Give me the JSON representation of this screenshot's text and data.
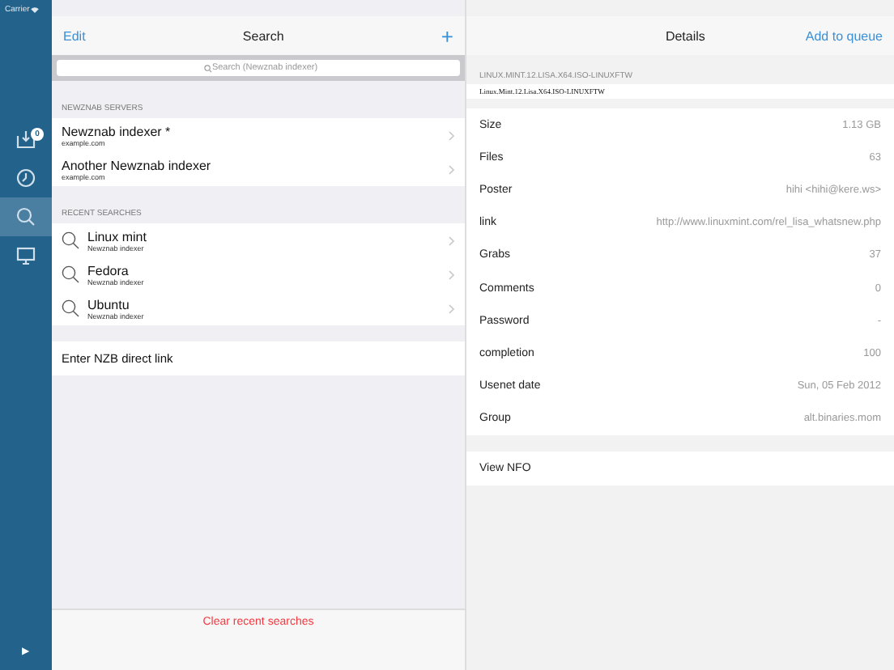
{
  "status_bar": {
    "carrier": "Carrier"
  },
  "sidebar": {
    "items": [
      {
        "kind": "downloads",
        "badge": "0",
        "selected": false
      },
      {
        "kind": "history",
        "selected": false
      },
      {
        "kind": "search",
        "selected": true
      },
      {
        "kind": "screen",
        "selected": false
      }
    ],
    "play": "▶"
  },
  "search_panel": {
    "edit": "Edit",
    "title": "Search",
    "add": "+",
    "search": {
      "placeholder": "Search (Newznab indexer)"
    },
    "sections": [
      {
        "header": "NEWZNAB SERVERS",
        "items": [
          {
            "kind": "server",
            "title": "Newznab indexer *",
            "subtitle": "example.com"
          },
          {
            "kind": "server",
            "title": "Another Newznab indexer",
            "subtitle": "example.com"
          }
        ]
      },
      {
        "header": "RECENT SEARCHES",
        "items": [
          {
            "kind": "search",
            "title": "Linux mint",
            "subtitle": "Newznab indexer"
          },
          {
            "kind": "search",
            "title": "Fedora",
            "subtitle": "Newznab indexer"
          },
          {
            "kind": "search",
            "title": "Ubuntu",
            "subtitle": "Newznab indexer"
          }
        ]
      }
    ],
    "direct_link": "Enter NZB direct link",
    "clear": "Clear recent searches"
  },
  "details": {
    "title": "Details",
    "action": "Add to queue",
    "caption": "LINUX.MINT.12.LISA.X64.ISO-LINUXFTW",
    "name": "Linux.Mint.12.Lisa.X64.ISO-LINUXFTW",
    "rows": [
      {
        "label": "Size",
        "value": "1.13 GB"
      },
      {
        "label": "Files",
        "value": "63"
      },
      {
        "label": "Poster",
        "value": "hihi <hihi@kere.ws>"
      },
      {
        "label": "link",
        "value": "http://www.linuxmint.com/rel_lisa_whatsnew.php"
      },
      {
        "label": "Grabs",
        "value": "37"
      },
      {
        "label": "Comments",
        "value": "0"
      },
      {
        "label": "Password",
        "value": "-"
      },
      {
        "label": "completion",
        "value": "100"
      },
      {
        "label": "Usenet date",
        "value": "Sun, 05 Feb 2012"
      },
      {
        "label": "Group",
        "value": "alt.binaries.mom"
      }
    ],
    "view_nfo": "View NFO"
  }
}
